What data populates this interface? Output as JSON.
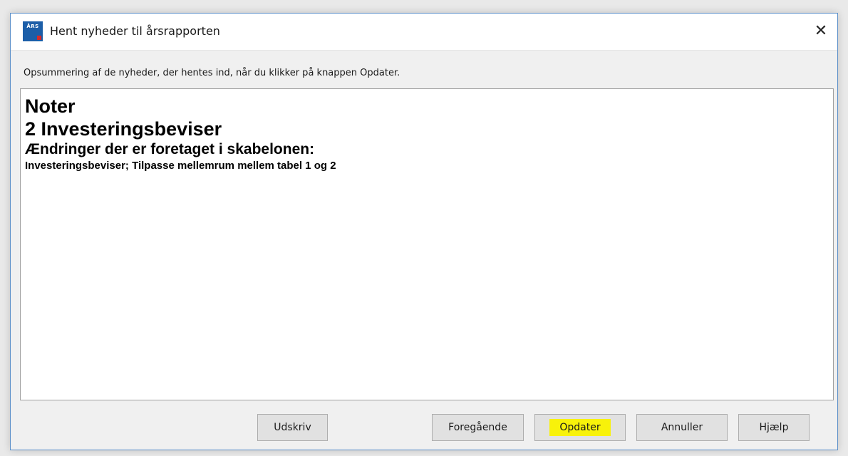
{
  "window": {
    "title": "Hent nyheder til årsrapporten",
    "app_icon_text": "ÅRS",
    "close_glyph": "✕"
  },
  "description": "Opsummering af de nyheder, der hentes ind, når du klikker på knappen Opdater.",
  "content": {
    "heading1": "Noter",
    "heading2": "2 Investeringsbeviser",
    "subheading": "Ændringer der er foretaget i skabelonen:",
    "detail": "Investeringsbeviser; Tilpasse mellemrum mellem tabel 1 og 2"
  },
  "buttons": {
    "print": "Udskriv",
    "previous": "Foregående",
    "update": "Opdater",
    "cancel": "Annuller",
    "help": "Hjælp"
  },
  "colors": {
    "highlight": "#f8f20a",
    "app_icon": "#1c5ea8"
  }
}
